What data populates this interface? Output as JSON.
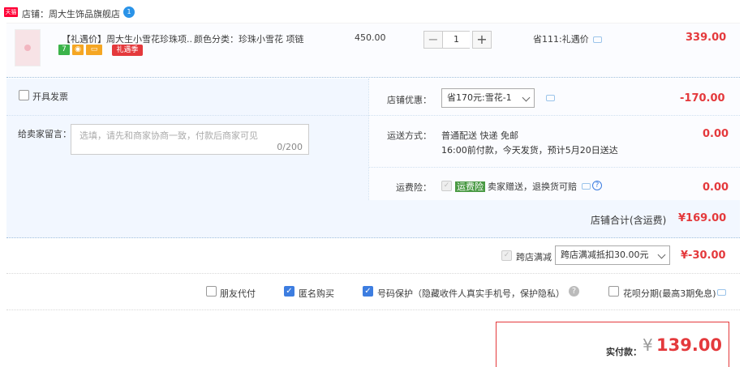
{
  "shop": {
    "tag": "天猫",
    "label": "店铺：",
    "name": "周大生饰品旗舰店",
    "chat_badge": "1"
  },
  "product": {
    "title": "【礼遇价】周大生小雪花珍珠项...",
    "sku_label": "颜色分类：",
    "sku_value": "珍珠小雪花 项链",
    "price": "450.00",
    "quantity": "1",
    "minus": "−",
    "plus": "+",
    "discount_text": "省111:礼遇价",
    "subtotal": "339.00",
    "badges": [
      "7",
      "",
      ""
    ],
    "promo_badge": "礼遇季"
  },
  "invoice": {
    "label": "开具发票"
  },
  "message": {
    "label": "给卖家留言：",
    "placeholder": "选填，请先和商家协商一致，付款后商家可见",
    "counter": "0/200"
  },
  "shop_discount": {
    "label": "店铺优惠：",
    "selected": "省170元:雪花-1",
    "amount": "-170.00"
  },
  "shipping": {
    "label": "运送方式：",
    "method": "普通配送 快递 免邮",
    "note": "16:00前付款，今天发货，预计5月20日送达",
    "amount": "0.00"
  },
  "insurance": {
    "label": "运费险：",
    "tag": "运费险",
    "text": "卖家赠送，退换货可赔",
    "amount": "0.00",
    "help": "?"
  },
  "shop_total": {
    "label": "店铺合计(含运费)",
    "amount": "¥169.00"
  },
  "cross_store": {
    "label": "跨店满减",
    "selected": "跨店满减抵扣30.00元",
    "amount": "¥-30.00"
  },
  "options": {
    "friend_pay": "朋友代付",
    "anonymous": "匿名购买",
    "number_protect": "号码保护（隐藏收件人真实手机号，保护隐私）",
    "number_help": "?",
    "huabei": "花呗分期(最高3期免息)"
  },
  "payment": {
    "label": "实付款：",
    "currency": "¥",
    "amount": "139.00"
  },
  "colors": {
    "accent_red": "#e4393c",
    "checkbox_blue": "#3d7de0",
    "panel_blue": "#f2f7ff"
  }
}
